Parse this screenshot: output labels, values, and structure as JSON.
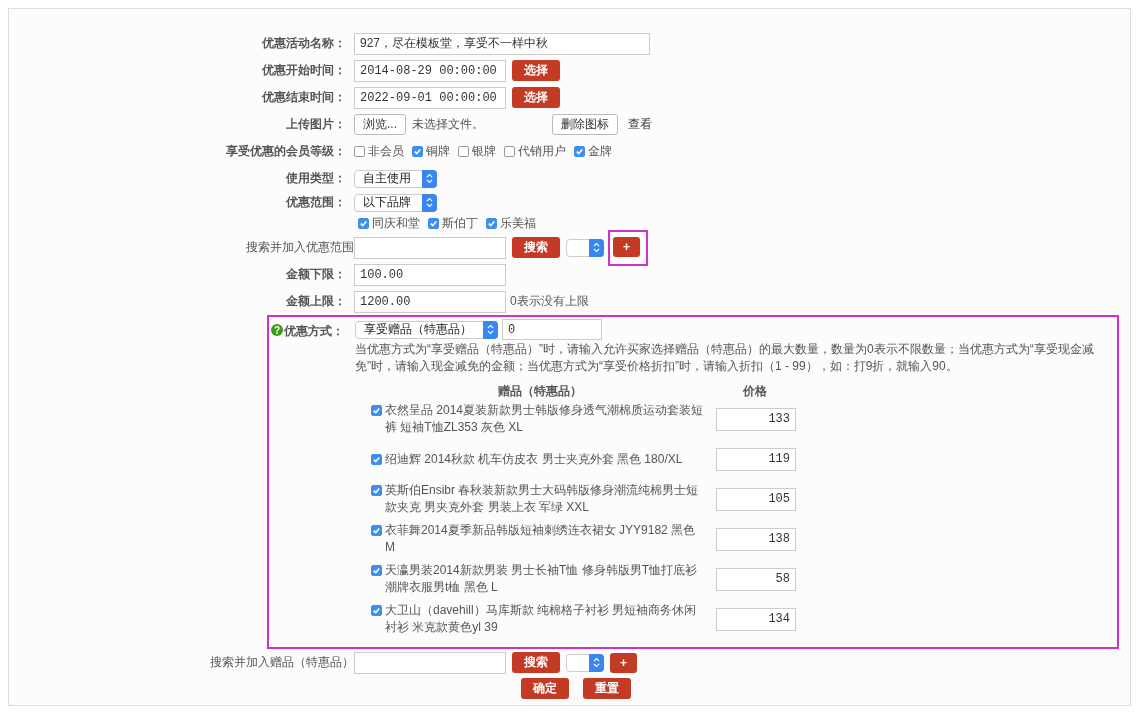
{
  "name_field": {
    "label": "优惠活动名称：",
    "value": "927，尽在模板堂，享受不一样中秋"
  },
  "start_time": {
    "label": "优惠开始时间：",
    "value": "2014-08-29 00:00:00",
    "button": "选择"
  },
  "end_time": {
    "label": "优惠结束时间：",
    "value": "2022-09-01 00:00:00",
    "button": "选择"
  },
  "upload": {
    "label": "上传图片：",
    "browse": "浏览...",
    "status": "未选择文件。",
    "delete": "删除图标",
    "view": "查看"
  },
  "member_levels": {
    "label": "享受优惠的会员等级：",
    "options": [
      {
        "label": "非会员",
        "checked": false
      },
      {
        "label": "铜牌",
        "checked": true
      },
      {
        "label": "银牌",
        "checked": false
      },
      {
        "label": "代销用户",
        "checked": false
      },
      {
        "label": "金牌",
        "checked": true
      }
    ]
  },
  "use_type": {
    "label": "使用类型：",
    "value": "自主使用"
  },
  "scope": {
    "label": "优惠范围：",
    "value": "以下品牌",
    "brands": [
      {
        "label": "同庆和堂",
        "checked": true
      },
      {
        "label": "斯伯丁",
        "checked": true
      },
      {
        "label": "乐美福",
        "checked": true
      }
    ]
  },
  "scope_search": {
    "label": "搜索并加入优惠范围",
    "search": "搜索",
    "add": "+",
    "highlighted": true
  },
  "min_amount": {
    "label": "金额下限：",
    "value": "100.00"
  },
  "max_amount": {
    "label": "金额上限：",
    "value": "1200.00",
    "hint": "0表示没有上限"
  },
  "mode": {
    "label": "优惠方式：",
    "help": "?",
    "value": "享受赠品（特惠品）",
    "quantity": "0",
    "highlighted": true,
    "note": "当优惠方式为“享受赠品（特惠品）”时，请输入允许买家选择赠品（特惠品）的最大数量，数量为0表示不限数量；当优惠方式为“享受现金减免”时，请输入现金减免的金额；当优惠方式为“享受价格折扣”时，请输入折扣（1 - 99），如：打9折，就输入90。",
    "columns": [
      "赠品（特惠品）",
      "价格"
    ],
    "gifts": [
      {
        "name": "衣然呈品 2014夏装新款男士韩版修身透气潮棉质运动套装短裤 短袖T恤ZL353 灰色 XL",
        "checked": true,
        "price": "133"
      },
      {
        "name": "绍迪辉 2014秋款 机车仿皮衣 男士夹克外套 黑色 180/XL",
        "checked": true,
        "price": "119"
      },
      {
        "name": "英斯伯Ensibr 春秋装新款男士大码韩版修身潮流纯棉男士短款夹克 男夹克外套 男装上衣 军绿 XXL",
        "checked": true,
        "price": "105"
      },
      {
        "name": "衣菲舞2014夏季新品韩版短袖刺绣连衣裙女 JYY9182 黑色 M",
        "checked": true,
        "price": "138"
      },
      {
        "name": "天瀛男装2014新款男装 男士长袖T恤 修身韩版男T恤打底衫潮牌衣服男t桖 黑色 L",
        "checked": true,
        "price": "58"
      },
      {
        "name": "大卫山（davehill）马库斯款 纯棉格子衬衫 男短袖商务休闲衬衫 米克款黄色yl 39",
        "checked": true,
        "price": "134"
      }
    ]
  },
  "gift_search": {
    "label": "搜索并加入赠品（特惠品）",
    "search": "搜索",
    "add": "+"
  },
  "buttons": [
    "确定",
    "重置"
  ]
}
